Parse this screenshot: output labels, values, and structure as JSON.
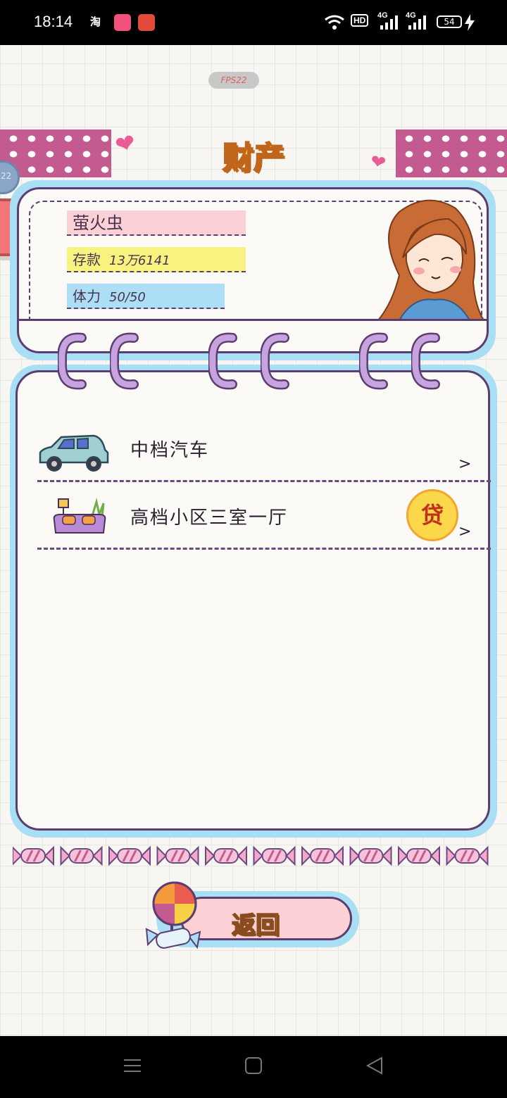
{
  "status_bar": {
    "time": "18:14",
    "network_hd": "HD",
    "network_1": "4G",
    "network_2": "4G",
    "battery": "54"
  },
  "fps_badge": "FPS22",
  "side_bubble": "22",
  "page_title": "财产",
  "profile": {
    "name": "萤火虫",
    "savings_label": "存款",
    "savings_value": "13万6141",
    "energy_label": "体力",
    "energy_value": "50/50"
  },
  "assets": [
    {
      "label": "中档汽车",
      "icon": "car-icon",
      "loan": null
    },
    {
      "label": "高档小区三室一厅",
      "icon": "sofa-icon",
      "loan": "贷"
    }
  ],
  "chevron": ">",
  "back_button": {
    "label": "返回"
  },
  "colors": {
    "title_yellow": "#f9c632",
    "accent_blue": "#a9dff4",
    "outline_purple": "#5b3e6f",
    "pink": "#fbd1d6",
    "yellow": "#f8f37e"
  }
}
